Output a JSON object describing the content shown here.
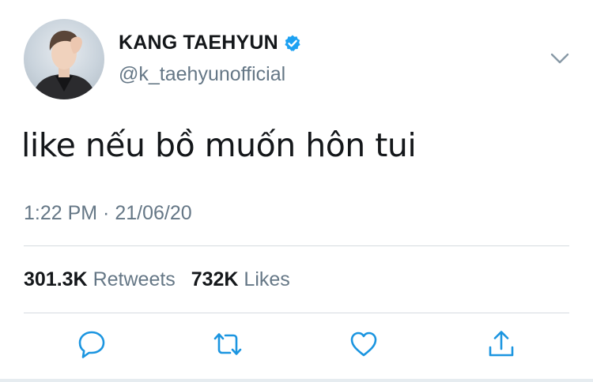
{
  "author": {
    "display_name": "KANG TAEHYUN",
    "handle": "@k_taehyunofficial",
    "verified": true,
    "avatar": "profile-photo"
  },
  "tweet": {
    "text": "like nếu bồ muốn hôn tui",
    "timestamp": "1:22 PM · 21/06/20"
  },
  "stats": {
    "retweets_count": "301.3K",
    "retweets_label": "Retweets",
    "likes_count": "732K",
    "likes_label": "Likes"
  },
  "actions": [
    {
      "name": "reply",
      "icon": "speech-bubble-icon"
    },
    {
      "name": "retweet",
      "icon": "retweet-arrows-icon"
    },
    {
      "name": "like",
      "icon": "heart-icon"
    },
    {
      "name": "share",
      "icon": "share-arrow-icon"
    }
  ],
  "colors": {
    "verified_blue": "#1da1f2",
    "secondary_text": "#657786",
    "primary_text": "#14171a",
    "icon_blue": "#1b95e0"
  }
}
